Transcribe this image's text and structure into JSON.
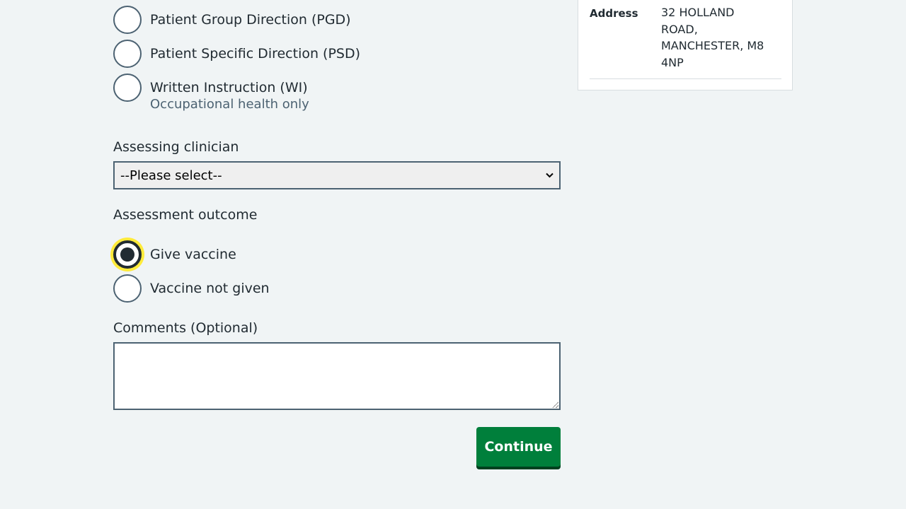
{
  "consent_method": {
    "options": [
      {
        "label": "Patient Group Direction (PGD)",
        "checked": false
      },
      {
        "label": "Patient Specific Direction (PSD)",
        "checked": false
      },
      {
        "label": "Written Instruction (WI)",
        "hint": "Occupational health only",
        "checked": false
      }
    ]
  },
  "assessing_clinician": {
    "label": "Assessing clinician",
    "selected": "--Please select--"
  },
  "assessment_outcome": {
    "label": "Assessment outcome",
    "options": [
      {
        "label": "Give vaccine",
        "checked": true
      },
      {
        "label": "Vaccine not given",
        "checked": false
      }
    ]
  },
  "comments": {
    "label": "Comments (Optional)",
    "value": ""
  },
  "actions": {
    "continue_label": "Continue"
  },
  "patient_summary": {
    "address_key": "Address",
    "address_value": "32 HOLLAND ROAD, MANCHESTER, M8 4NP"
  },
  "colors": {
    "background": "#f0f4f5",
    "primary_button": "#007f3b",
    "focus": "#ffeb3b",
    "border": "#4c6272"
  }
}
